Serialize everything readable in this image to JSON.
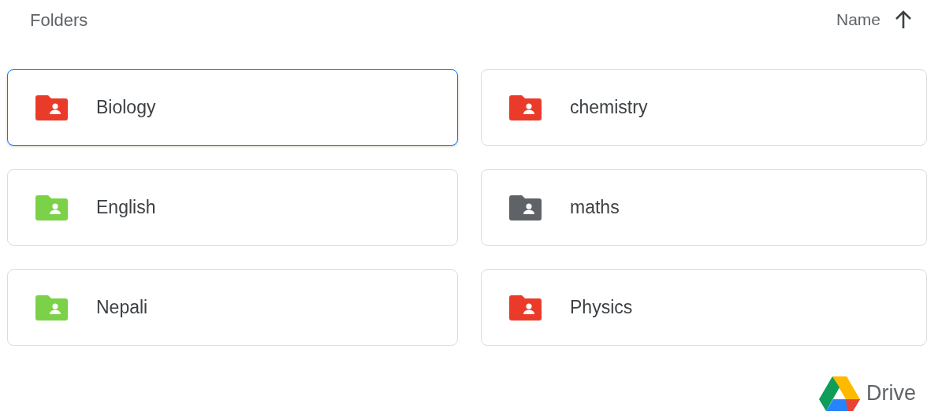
{
  "section_title": "Folders",
  "sort": {
    "label": "Name",
    "ascending": true
  },
  "folders": [
    {
      "name": "Biology",
      "color": "#ea3b2a",
      "selected": true
    },
    {
      "name": "chemistry",
      "color": "#ea3b2a",
      "selected": false
    },
    {
      "name": "English",
      "color": "#7bd148",
      "selected": false
    },
    {
      "name": "maths",
      "color": "#5f6368",
      "selected": false
    },
    {
      "name": "Nepali",
      "color": "#7bd148",
      "selected": false
    },
    {
      "name": "Physics",
      "color": "#ea3b2a",
      "selected": false
    }
  ],
  "footer": {
    "brand": "Drive"
  }
}
